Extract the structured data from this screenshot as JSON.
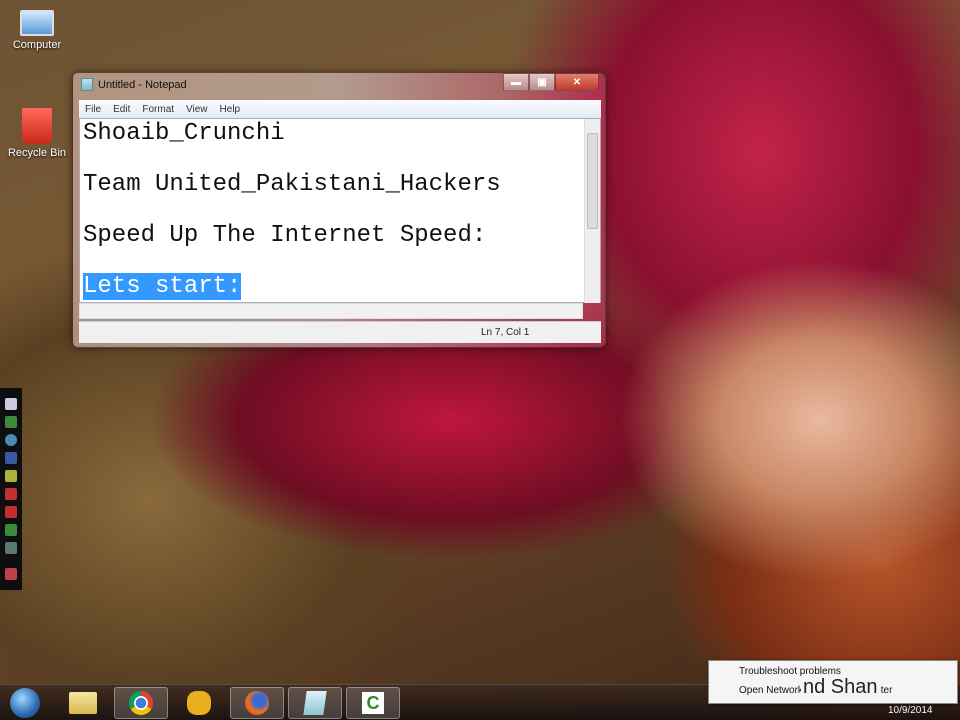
{
  "desktop": {
    "icons": [
      {
        "label": "Computer",
        "icon": "computer-icon"
      },
      {
        "label": "Recycle Bin",
        "icon": "recycle-bin-icon"
      }
    ]
  },
  "notepad": {
    "title": "Untitled - Notepad",
    "menu": [
      "File",
      "Edit",
      "Format",
      "View",
      "Help"
    ],
    "lines": [
      "Shoaib_Crunchi",
      "Team United_Pakistani_Hackers",
      "Speed Up The Internet Speed:",
      "Lets start:"
    ],
    "status": "Ln 7, Col 1",
    "minimize": "▬",
    "maximize": "▣",
    "close": "✕"
  },
  "taskbar": {
    "apps": [
      "start-orb",
      "windows-explorer",
      "google-chrome",
      "app-yellow",
      "firefox",
      "notepad",
      "camtasia"
    ],
    "date": "10/9/2014"
  },
  "context_menu": {
    "items": [
      "Troubleshoot problems",
      "Open Network and Sharing Center"
    ],
    "overlay_caption": "nd Shan"
  },
  "colors": {
    "selection": "#3399ff"
  }
}
